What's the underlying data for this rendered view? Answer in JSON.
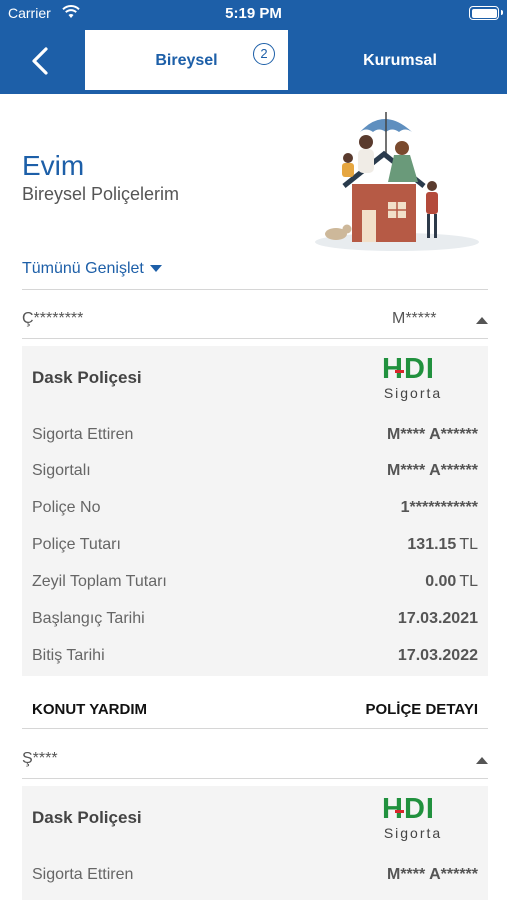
{
  "status_bar": {
    "carrier": "Carrier",
    "time": "5:19 PM"
  },
  "header": {
    "tabs": [
      {
        "label": "Bireysel",
        "badge": "2",
        "active": true
      },
      {
        "label": "Kurumsal",
        "active": false
      }
    ]
  },
  "hero": {
    "title": "Evim",
    "subtitle": "Bireysel Poliçelerim"
  },
  "expand_all": "Tümünü Genişlet",
  "groups": [
    {
      "owner": "Ç********",
      "insured": "M*****",
      "card": {
        "type": "Dask Poliçesi",
        "brand": {
          "name": "HDI",
          "sub": "Sigorta"
        },
        "rows": [
          {
            "label": "Sigorta Ettiren",
            "value": "M**** A******",
            "unit": ""
          },
          {
            "label": "Sigortalı",
            "value": "M**** A******",
            "unit": ""
          },
          {
            "label": "Poliçe No",
            "value": "1***********",
            "unit": ""
          },
          {
            "label": "Poliçe Tutarı",
            "value": "131.15",
            "unit": "TL"
          },
          {
            "label": "Zeyil Toplam Tutarı",
            "value": "0.00",
            "unit": "TL"
          },
          {
            "label": "Başlangıç Tarihi",
            "value": "17.03.2021",
            "unit": ""
          },
          {
            "label": "Bitiş Tarihi",
            "value": "17.03.2022",
            "unit": ""
          }
        ]
      },
      "actions": {
        "left": "KONUT YARDIM",
        "right": "POLİÇE DETAYI"
      }
    },
    {
      "owner": "Ş****",
      "insured": "",
      "card": {
        "type": "Dask Poliçesi",
        "brand": {
          "name": "HDI",
          "sub": "Sigorta"
        },
        "rows": [
          {
            "label": "Sigorta Ettiren",
            "value": "M**** A******",
            "unit": ""
          }
        ]
      }
    }
  ],
  "colors": {
    "brand_blue": "#1d5fa8",
    "hdi_green": "#21913e",
    "hdi_red": "#d8262b",
    "card_bg": "#f4f4f4"
  },
  "icons": [
    "wifi-icon",
    "battery-icon",
    "back-chevron-icon",
    "caret-down-icon",
    "caret-up-icon",
    "family-umbrella-house-illustration",
    "hdi-logo"
  ]
}
